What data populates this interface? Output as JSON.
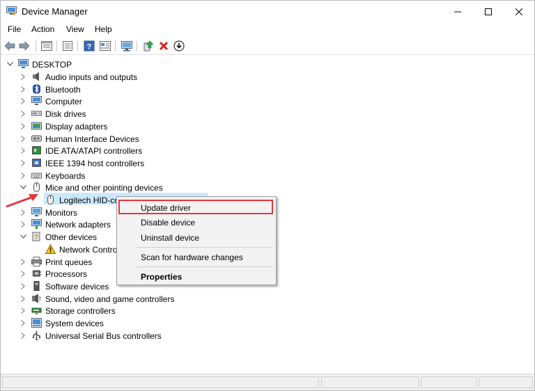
{
  "window": {
    "title": "Device Manager",
    "app_icon": "device-manager-icon"
  },
  "title_buttons": {
    "minimize": "minimize-icon",
    "maximize": "maximize-icon",
    "close": "close-icon"
  },
  "menu": [
    "File",
    "Action",
    "View",
    "Help"
  ],
  "toolbar": [
    "back-icon",
    "forward-icon",
    "properties-icon",
    "list-icon",
    "help-icon",
    "resources-icon",
    "scan-hardware-icon",
    "update-driver-icon",
    "uninstall-icon",
    "download-icon"
  ],
  "tree": {
    "root": "DESKTOP",
    "items": [
      {
        "label": "Audio inputs and outputs",
        "icon": "speaker-icon",
        "expanded": false
      },
      {
        "label": "Bluetooth",
        "icon": "bluetooth-icon",
        "expanded": false
      },
      {
        "label": "Computer",
        "icon": "computer-icon",
        "expanded": false
      },
      {
        "label": "Disk drives",
        "icon": "disk-icon",
        "expanded": false
      },
      {
        "label": "Display adapters",
        "icon": "display-icon",
        "expanded": false
      },
      {
        "label": "Human Interface Devices",
        "icon": "hid-icon",
        "expanded": false
      },
      {
        "label": "IDE ATA/ATAPI controllers",
        "icon": "ide-icon",
        "expanded": false
      },
      {
        "label": "IEEE 1394 host controllers",
        "icon": "ieee-icon",
        "expanded": false
      },
      {
        "label": "Keyboards",
        "icon": "keyboard-icon",
        "expanded": false
      },
      {
        "label": "Mice and other pointing devices",
        "icon": "mouse-icon",
        "expanded": true
      },
      {
        "label": "Logitech HID-co",
        "icon": "mouse-icon",
        "child": true,
        "selected": true
      },
      {
        "label": "Monitors",
        "icon": "monitor-icon",
        "expanded": false
      },
      {
        "label": "Network adapters",
        "icon": "network-icon",
        "expanded": false
      },
      {
        "label": "Other devices",
        "icon": "other-devices-icon",
        "expanded": true
      },
      {
        "label": "Network Contro",
        "icon": "warning-icon",
        "child": true
      },
      {
        "label": "Print queues",
        "icon": "printer-icon",
        "expanded": false
      },
      {
        "label": "Processors",
        "icon": "processor-icon",
        "expanded": false
      },
      {
        "label": "Software devices",
        "icon": "software-icon",
        "expanded": false
      },
      {
        "label": "Sound, video and game controllers",
        "icon": "sound-icon",
        "expanded": false
      },
      {
        "label": "Storage controllers",
        "icon": "storage-icon",
        "expanded": false
      },
      {
        "label": "System devices",
        "icon": "system-icon",
        "expanded": false
      },
      {
        "label": "Universal Serial Bus controllers",
        "icon": "usb-icon",
        "expanded": false
      }
    ]
  },
  "context_menu": {
    "items": [
      "Update driver",
      "Disable device",
      "Uninstall device",
      "Scan for hardware changes",
      "Properties"
    ],
    "highlighted": "Update driver"
  },
  "colors": {
    "selection": "#cce8ff",
    "highlight_box": "#e0383c",
    "arrow": "#e0383c"
  }
}
